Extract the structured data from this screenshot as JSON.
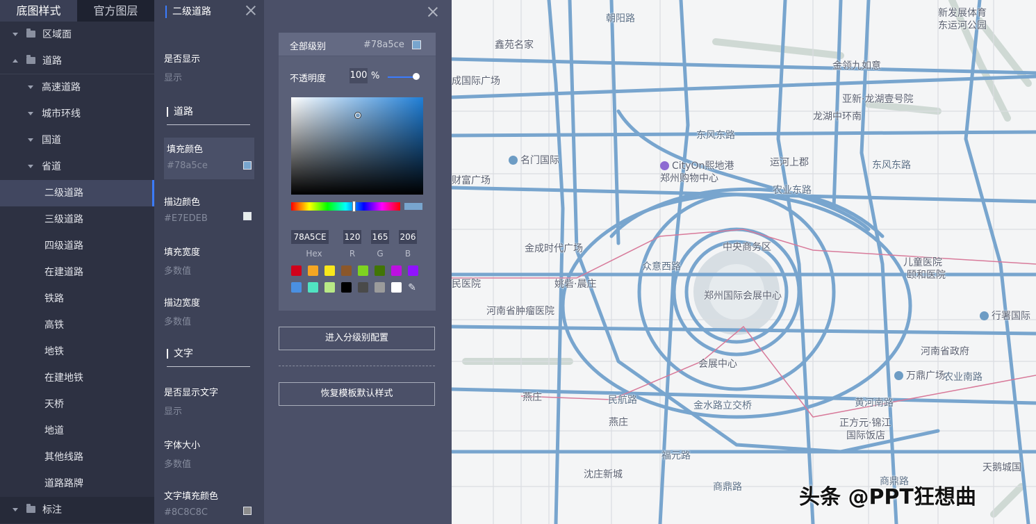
{
  "tabs": [
    {
      "label": "底图样式",
      "active": true
    },
    {
      "label": "官方图层",
      "active": false
    }
  ],
  "tree": {
    "area": "区域面",
    "road": "道路",
    "items": [
      "高速道路",
      "城市环线",
      "国道",
      "省道"
    ],
    "subitems": [
      "二级道路",
      "三级道路",
      "四级道路",
      "在建道路",
      "铁路",
      "高铁",
      "地铁",
      "在建地铁",
      "天桥",
      "地道",
      "其他线路",
      "道路路牌"
    ],
    "selected": "二级道路",
    "annotation": "标注"
  },
  "props": {
    "title": "二级道路",
    "show_label": "是否显示",
    "show_value": "显示",
    "road_section": "道路",
    "fill_color_label": "填充颜色",
    "fill_color_value": "#78a5ce",
    "stroke_color_label": "描边颜色",
    "stroke_color_value": "#E7EDEB",
    "fill_width_label": "填充宽度",
    "fill_width_value": "多数值",
    "stroke_width_label": "描边宽度",
    "stroke_width_value": "多数值",
    "text_section": "文字",
    "show_text_label": "是否显示文字",
    "show_text_value": "显示",
    "font_size_label": "字体大小",
    "font_size_value": "多数值",
    "text_fill_label": "文字填充颜色",
    "text_fill_value": "#8C8C8C"
  },
  "picker": {
    "level_label": "全部级别",
    "level_hex": "#78a5ce",
    "opacity_label": "不透明度",
    "opacity_value": "100",
    "opacity_unit": "%",
    "opacity_level": 1.0,
    "hex": "78A5CE",
    "r": "120",
    "g": "165",
    "b": "206",
    "labels": {
      "hex": "Hex",
      "r": "R",
      "g": "G",
      "b": "B"
    },
    "presets": [
      "#d0021b",
      "#f5a623",
      "#f8e71c",
      "#8b572a",
      "#7ed321",
      "#417505",
      "#bd10e0",
      "#9013fe",
      "#4a90e2",
      "#50e3c2",
      "#b8e986",
      "#000000",
      "#4a4a4a",
      "#9b9b9b",
      "#ffffff"
    ],
    "btn_levels": "进入分级别配置",
    "btn_reset": "恢复模板默认样式"
  },
  "colors": {
    "accent": "#3b7cff",
    "road": "#78a5ce",
    "rail": "#d87a9a"
  },
  "map": {
    "labels": [
      "朝阳路",
      "新发展体育",
      "东运河公园",
      "鑫苑名家",
      "金领九如意",
      "成国际广场",
      "亚新·龙湖壹号院",
      "龙湖中环南",
      "东风东路",
      "名门国际",
      "CityOn熙地港",
      "郑州购物中心",
      "运河上郡",
      "东风东路",
      "财富广场",
      "农业东路",
      "中央商务区",
      "金成时代广场",
      "众意西路",
      "儿童医院",
      "郑州国际会展中心",
      "颐和医院",
      "民医院",
      "姚砦·晨庄",
      "河南省肿瘤医院",
      "行署国际",
      "河南省政府",
      "会展中心",
      "万鼎广场",
      "农业南路",
      "燕庄",
      "民航路",
      "金水路立交桥",
      "黄河南路",
      "燕庄",
      "正方元·锦江",
      "国际饭店",
      "福元路",
      "沈庄新城",
      "商鼎路",
      "天鹅城国",
      "商鼎路"
    ],
    "watermark": "头条 @PPT狂想曲"
  }
}
